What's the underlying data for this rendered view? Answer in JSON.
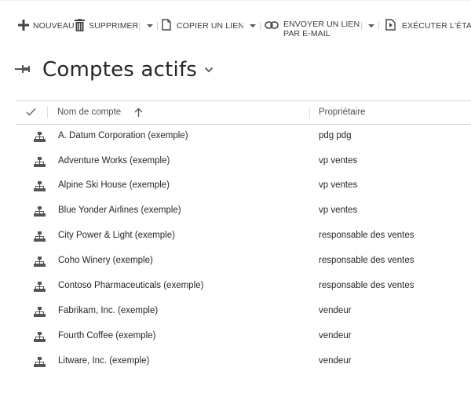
{
  "toolbar": {
    "new_label": "NOUVEAU",
    "delete_label": "SUPPRIMER",
    "copy_link_label": "COPIER UN LIEN",
    "email_link_label_line1": "ENVOYER UN LIEN",
    "email_link_label_line2": "PAR E-MAIL",
    "run_report_label": "EXÉCUTER L'ÉTAT"
  },
  "view": {
    "title": "Comptes actifs"
  },
  "grid": {
    "columns": {
      "name": "Nom de compte",
      "owner": "Propriétaire"
    },
    "sort_direction": "ascending",
    "rows": [
      {
        "name": "A. Datum Corporation (exemple)",
        "owner": "pdg pdg"
      },
      {
        "name": "Adventure Works (exemple)",
        "owner": "vp ventes"
      },
      {
        "name": "Alpine Ski House (exemple)",
        "owner": "vp ventes"
      },
      {
        "name": "Blue Yonder Airlines (exemple)",
        "owner": "vp ventes"
      },
      {
        "name": "City Power & Light (exemple)",
        "owner": "responsable des ventes"
      },
      {
        "name": "Coho Winery (exemple)",
        "owner": "responsable des ventes"
      },
      {
        "name": "Contoso Pharmaceuticals (exemple)",
        "owner": "responsable des ventes"
      },
      {
        "name": "Fabrikam, Inc. (exemple)",
        "owner": "vendeur"
      },
      {
        "name": "Fourth Coffee (exemple)",
        "owner": "vendeur"
      },
      {
        "name": "Litware, Inc. (exemple)",
        "owner": "vendeur"
      }
    ]
  },
  "icons": {
    "new": "plus-icon",
    "delete": "trash-icon",
    "copy_link": "document-icon",
    "email_link": "link-icon",
    "run_report": "report-icon",
    "pin": "pin-icon",
    "view_selector": "chevron-down-icon",
    "select_all": "checkmark-icon",
    "sort": "arrow-up-icon",
    "account": "hierarchy-icon"
  },
  "colors": {
    "text": "#262626",
    "toolbar_text": "#3b3b3b",
    "icon": "#505050",
    "border": "#d8d8d8"
  }
}
